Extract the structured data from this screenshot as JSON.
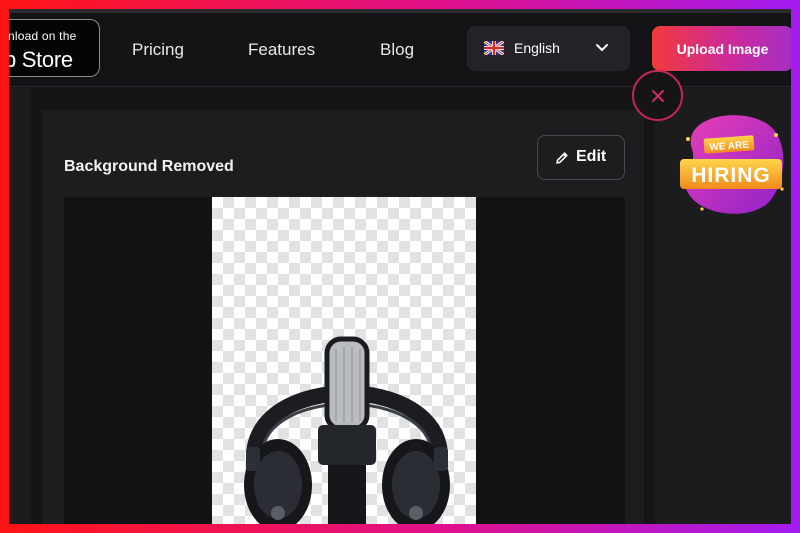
{
  "header": {
    "appstore": {
      "small_text": "nload on the",
      "big_text": "p Store"
    },
    "nav": [
      {
        "label": "Pricing"
      },
      {
        "label": "Features"
      },
      {
        "label": "Blog"
      }
    ],
    "language": {
      "selected": "English",
      "flag_icon": "uk-flag-icon"
    },
    "upload_label": "Upload Image"
  },
  "main": {
    "title": "Background Removed",
    "edit_label": "Edit",
    "preview_subject": "microphone with headphones"
  },
  "promo": {
    "line1": "WE ARE",
    "line2": "HIRING"
  },
  "colors": {
    "accent_start": "#f23a3a",
    "accent_end": "#a52ec4",
    "background": "#151517",
    "close_ring": "#c8245c"
  }
}
